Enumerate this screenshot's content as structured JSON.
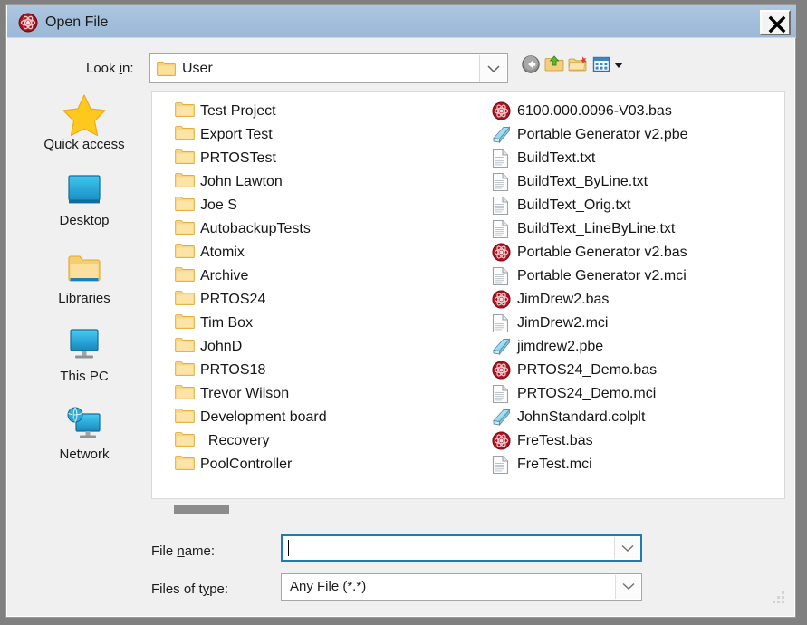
{
  "window": {
    "title": "Open File",
    "title_icon": "atom-badge-icon",
    "close_label": "×"
  },
  "lookin": {
    "label_pre": "Look ",
    "label_accel": "i",
    "label_post": "n:",
    "value": "User",
    "folder_icon": "folder-icon",
    "dropdown_icon": "chevron-down-icon"
  },
  "toolbar": {
    "items": [
      {
        "name": "back-button",
        "icon": "back-arrow-icon",
        "tooltip": "Back"
      },
      {
        "name": "up-folder-button",
        "icon": "up-folder-icon",
        "tooltip": "Up One Level"
      },
      {
        "name": "new-folder-button",
        "icon": "new-folder-icon",
        "tooltip": "Create New Folder"
      },
      {
        "name": "view-menu-button",
        "icon": "view-grid-icon",
        "tooltip": "View Menu"
      },
      {
        "name": "view-menu-arrow",
        "icon": "caret-down-icon",
        "tooltip": "More views"
      }
    ]
  },
  "places": [
    {
      "label": "Quick access",
      "icon": "star-icon"
    },
    {
      "label": "Desktop",
      "icon": "desktop-screen-icon"
    },
    {
      "label": "Libraries",
      "icon": "folder-icon"
    },
    {
      "label": "This PC",
      "icon": "monitor-icon"
    },
    {
      "label": "Network",
      "icon": "network-globe-icon"
    }
  ],
  "file_list": {
    "folders": [
      {
        "name": "Test Project",
        "icon": "folder-icon"
      },
      {
        "name": "Export Test",
        "icon": "folder-icon"
      },
      {
        "name": "PRTOSTest",
        "icon": "folder-icon"
      },
      {
        "name": "John Lawton",
        "icon": "folder-icon"
      },
      {
        "name": "Joe S",
        "icon": "folder-icon"
      },
      {
        "name": "AutobackupTests",
        "icon": "folder-icon"
      },
      {
        "name": "Atomix",
        "icon": "folder-icon"
      },
      {
        "name": "Archive",
        "icon": "folder-icon"
      },
      {
        "name": "PRTOS24",
        "icon": "folder-icon"
      },
      {
        "name": "Tim Box",
        "icon": "folder-icon"
      },
      {
        "name": "JohnD",
        "icon": "folder-icon"
      },
      {
        "name": "PRTOS18",
        "icon": "folder-icon"
      },
      {
        "name": "Trevor Wilson",
        "icon": "folder-icon"
      },
      {
        "name": "Development board",
        "icon": "folder-icon"
      },
      {
        "name": "_Recovery",
        "icon": "folder-icon"
      },
      {
        "name": "PoolController",
        "icon": "folder-icon"
      }
    ],
    "files": [
      {
        "name": "6100.000.0096-V03.bas",
        "icon": "bas-atom-icon"
      },
      {
        "name": "Portable Generator v2.pbe",
        "icon": "pbe-book-icon"
      },
      {
        "name": "BuildText.txt",
        "icon": "text-document-icon"
      },
      {
        "name": "BuildText_ByLine.txt",
        "icon": "text-document-icon"
      },
      {
        "name": "BuildText_Orig.txt",
        "icon": "text-document-icon"
      },
      {
        "name": "BuildText_LineByLine.txt",
        "icon": "text-document-icon"
      },
      {
        "name": "Portable Generator v2.bas",
        "icon": "bas-atom-icon"
      },
      {
        "name": "Portable Generator v2.mci",
        "icon": "text-document-icon"
      },
      {
        "name": "JimDrew2.bas",
        "icon": "bas-atom-icon"
      },
      {
        "name": "JimDrew2.mci",
        "icon": "text-document-icon"
      },
      {
        "name": "jimdrew2.pbe",
        "icon": "pbe-book-icon"
      },
      {
        "name": "PRTOS24_Demo.bas",
        "icon": "bas-atom-icon"
      },
      {
        "name": "PRTOS24_Demo.mci",
        "icon": "text-document-icon"
      },
      {
        "name": "JohnStandard.colplt",
        "icon": "pbe-book-icon"
      },
      {
        "name": "FreTest.bas",
        "icon": "bas-atom-icon"
      },
      {
        "name": "FreTest.mci",
        "icon": "text-document-icon"
      }
    ]
  },
  "fields": {
    "filename": {
      "label_pre": "File ",
      "label_accel": "n",
      "label_post": "ame:",
      "value": "",
      "dropdown_icon": "chevron-down-icon"
    },
    "filetype": {
      "label_pre": "Files of t",
      "label_accel": "y",
      "label_post": "pe:",
      "value": "Any File (*.*)",
      "dropdown_icon": "chevron-down-icon"
    }
  },
  "colors": {
    "titlebar": "#a2bedb",
    "dialog_bg": "#f0f0f0",
    "list_bg": "#ffffff",
    "focus_border": "#1f7cb0",
    "folder_yellow": "#fbd26a",
    "bas_red": "#b4131f",
    "accent_blue": "#2ba8e0"
  }
}
